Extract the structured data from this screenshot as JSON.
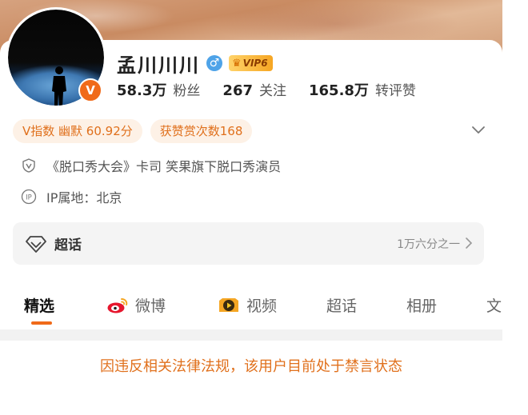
{
  "profile": {
    "name": "孟川川川",
    "gender_icon": "male-icon",
    "vip_label": "VIP6",
    "verified_badge": "V"
  },
  "stats": [
    {
      "value": "58.3万",
      "label": "粉丝"
    },
    {
      "value": "267",
      "label": "关注"
    },
    {
      "value": "165.8万",
      "label": "转评赞"
    }
  ],
  "chips": {
    "v_index": "V指数 幽默 60.92分",
    "likes": "获赞赏次数168"
  },
  "info": {
    "bio": "《脱口秀大会》卡司  笑果旗下脱口秀演员",
    "ip_location": "IP属地：北京"
  },
  "supertopic": {
    "label": "超话",
    "rank": "1万六分之一"
  },
  "tabs": [
    "精选",
    "微博",
    "视频",
    "超话",
    "相册",
    "文"
  ],
  "notice": "因违反相关法律法规，该用户目前处于禁言状态",
  "colors": {
    "accent": "#f06a19",
    "chip_text": "#e0701c",
    "chip_bg": "#fdf1e6",
    "gender": "#4ea3e8"
  }
}
